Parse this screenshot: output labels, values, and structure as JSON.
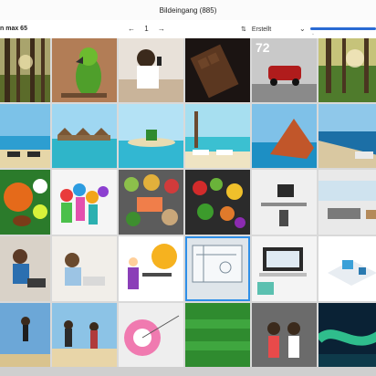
{
  "window": {
    "title": "Bildeingang (885)"
  },
  "toolbar": {
    "filter_text": "n max 65",
    "pager": {
      "prev_icon": "←",
      "page": "1",
      "next_icon": "→"
    },
    "sort": {
      "icon": "sort-icon",
      "label": "Erstellt",
      "chevron": "⌄"
    },
    "zoom_slider": {
      "value": 0.03,
      "knob": "◦"
    }
  },
  "grid": {
    "cells": [
      {
        "id": "r1c1",
        "overlay": ""
      },
      {
        "id": "r1c2",
        "overlay": ""
      },
      {
        "id": "r1c3",
        "overlay": ""
      },
      {
        "id": "r1c4",
        "overlay": ""
      },
      {
        "id": "r1c5",
        "overlay": "72"
      },
      {
        "id": "r1c6",
        "overlay": ""
      },
      {
        "id": "r2c1",
        "overlay": ""
      },
      {
        "id": "r2c2",
        "overlay": ""
      },
      {
        "id": "r2c3",
        "overlay": ""
      },
      {
        "id": "r2c4",
        "overlay": ""
      },
      {
        "id": "r2c5",
        "overlay": ""
      },
      {
        "id": "r2c6",
        "overlay": ""
      },
      {
        "id": "r3c1",
        "overlay": ""
      },
      {
        "id": "r3c2",
        "overlay": ""
      },
      {
        "id": "r3c3",
        "overlay": ""
      },
      {
        "id": "r3c4",
        "overlay": ""
      },
      {
        "id": "r3c5",
        "overlay": ""
      },
      {
        "id": "r3c6",
        "overlay": ""
      },
      {
        "id": "r4c1",
        "overlay": ""
      },
      {
        "id": "r4c2",
        "overlay": ""
      },
      {
        "id": "r4c3",
        "overlay": ""
      },
      {
        "id": "r4c4",
        "overlay": ""
      },
      {
        "id": "r4c5",
        "overlay": ""
      },
      {
        "id": "r4c6",
        "overlay": ""
      },
      {
        "id": "r5c1",
        "overlay": ""
      },
      {
        "id": "r5c2",
        "overlay": ""
      },
      {
        "id": "r5c3",
        "overlay": ""
      },
      {
        "id": "r5c4",
        "overlay": ""
      },
      {
        "id": "r5c5",
        "overlay": ""
      },
      {
        "id": "r5c6",
        "overlay": ""
      }
    ],
    "selected_cell": "r4c4"
  },
  "colors": {
    "accent": "#2a6bd4",
    "selection": "#2e8fe8",
    "background": "#d9d9d9"
  }
}
